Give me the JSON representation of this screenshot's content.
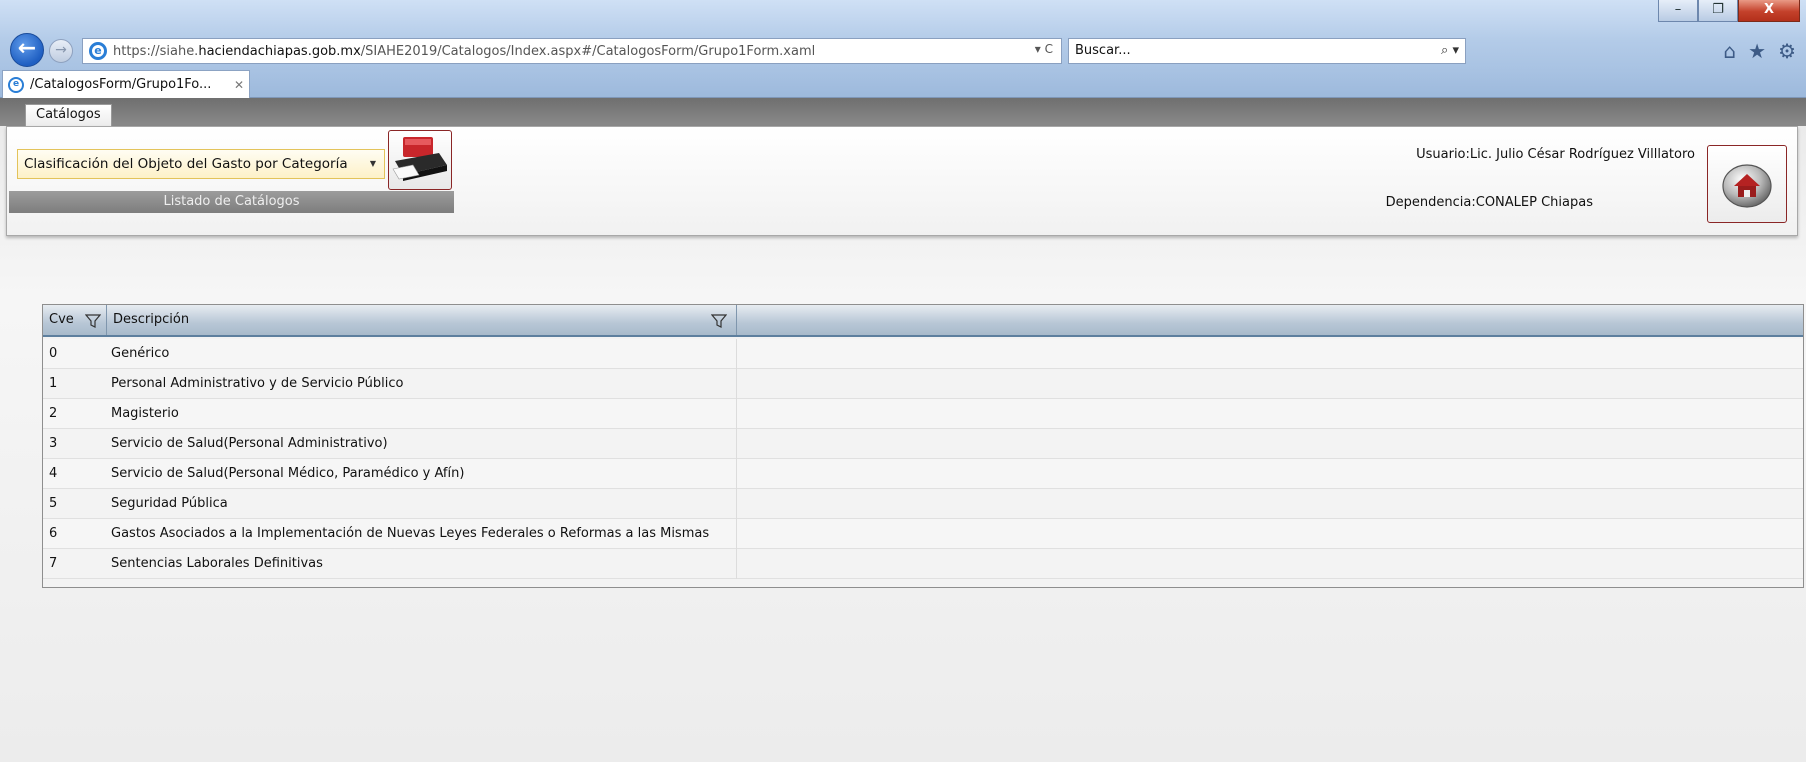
{
  "browser": {
    "url_prefix": "https://siahe.",
    "url_domain": "haciendachiapas.gob.mx",
    "url_path": "/SIAHE2019/Catalogos/Index.aspx#/CatalogosForm/Grupo1Form.xaml",
    "address_tail": "▾ C",
    "search_placeholder": "Buscar...",
    "tab_title": "/CatalogosForm/Grupo1Fo...",
    "tab_close": "✕",
    "win_minimize": "–",
    "win_maximize": "❐",
    "win_close": "X"
  },
  "app": {
    "tab_label": "Catálogos",
    "catalog_select_value": "Clasificación del Objeto del Gasto por Categoría",
    "group_caption": "Listado de Catálogos",
    "user_label": "Usuario:",
    "user_value": "Lic. Julio César Rodríguez Villlatoro",
    "dependency_label": "Dependencia:",
    "dependency_value": "CONALEP Chiapas"
  },
  "grid": {
    "columns": [
      "Cve",
      "Descripción"
    ],
    "rows": [
      {
        "cve": "0",
        "desc": "Genérico"
      },
      {
        "cve": "1",
        "desc": "Personal Administrativo y de Servicio Público"
      },
      {
        "cve": "2",
        "desc": "Magisterio"
      },
      {
        "cve": "3",
        "desc": "Servicio de Salud(Personal Administrativo)"
      },
      {
        "cve": "4",
        "desc": "Servicio de Salud(Personal Médico, Paramédico y Afín)"
      },
      {
        "cve": "5",
        "desc": "Seguridad Pública"
      },
      {
        "cve": "6",
        "desc": "Gastos Asociados a la Implementación de Nuevas Leyes Federales o Reformas a las Mismas"
      },
      {
        "cve": "7",
        "desc": "Sentencias Laborales Definitivas"
      }
    ]
  },
  "icons": {
    "back": "back-arrow-icon",
    "forward": "forward-arrow-icon",
    "ie": "ie-logo-icon",
    "search": "search-icon",
    "home": "home-icon",
    "favorites": "star-icon",
    "tools": "gear-icon",
    "print": "printer-icon",
    "filter": "filter-icon"
  },
  "colors": {
    "accent_blue": "#1f5fc2",
    "button_border": "#8a2626",
    "select_highlight": "#e3c35a"
  }
}
